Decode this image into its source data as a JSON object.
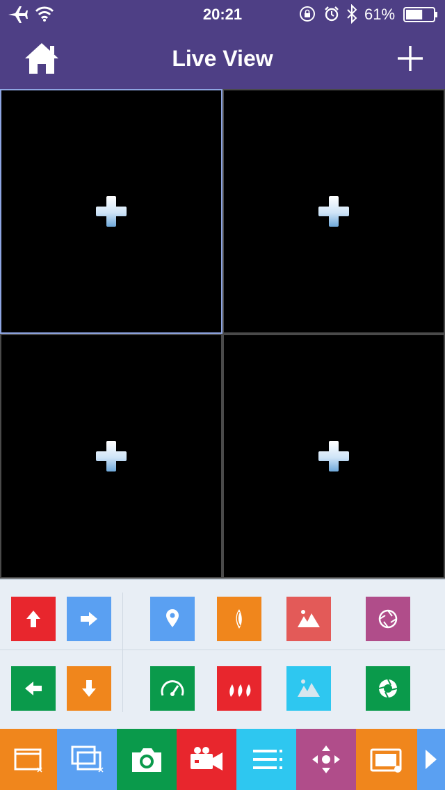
{
  "status_bar": {
    "time": "20:21",
    "battery_percent": "61%",
    "battery_level": 0.61,
    "icons": [
      "airplane-icon",
      "wifi-icon",
      "rotation-lock-icon",
      "alarm-icon",
      "bluetooth-icon",
      "battery-icon"
    ]
  },
  "nav": {
    "title": "Live View",
    "left_icon": "home-icon",
    "right_icon": "plus-icon",
    "bar_color": "#4e3f85"
  },
  "grid": {
    "cells": [
      {
        "selected": true,
        "icon": "add-camera-icon"
      },
      {
        "selected": false,
        "icon": "add-camera-icon"
      },
      {
        "selected": false,
        "icon": "add-camera-icon"
      },
      {
        "selected": false,
        "icon": "add-camera-icon"
      }
    ],
    "selected_border_color": "#8ea5e2"
  },
  "controls": {
    "ptz": [
      {
        "icon": "arrow-up-icon",
        "color": "#e8262d"
      },
      {
        "icon": "arrow-right-icon",
        "color": "#5aa0f2"
      },
      {
        "icon": "arrow-left-icon",
        "color": "#0a9a4b"
      },
      {
        "icon": "arrow-down-icon",
        "color": "#f0861c"
      }
    ],
    "functions": [
      {
        "icon": "location-pin-icon",
        "color": "#5aa0f2"
      },
      {
        "icon": "focus-icon",
        "color": "#f0861c"
      },
      {
        "icon": "image-icon",
        "color": "#e35a58"
      },
      {
        "icon": "iris-icon",
        "color": "#b04d8a"
      },
      {
        "icon": "speedometer-icon",
        "color": "#0a9a4b"
      },
      {
        "icon": "focus-far-icon",
        "color": "#e8262d"
      },
      {
        "icon": "image-light-icon",
        "color": "#2ec7f0"
      },
      {
        "icon": "iris-open-icon",
        "color": "#0a9a4b"
      }
    ]
  },
  "toolbar": {
    "items": [
      {
        "icon": "close-window-icon",
        "color": "#f0861c"
      },
      {
        "icon": "close-all-windows-icon",
        "color": "#5aa0f2"
      },
      {
        "icon": "camera-snapshot-icon",
        "color": "#0a9a4b"
      },
      {
        "icon": "video-record-icon",
        "color": "#e8262d"
      },
      {
        "icon": "list-icon",
        "color": "#2ec7f0"
      },
      {
        "icon": "move-icon",
        "color": "#b04d8a"
      },
      {
        "icon": "window-layout-icon",
        "color": "#f0861c"
      },
      {
        "icon": "next-arrow-icon",
        "color": "#5aa0f2"
      }
    ]
  }
}
